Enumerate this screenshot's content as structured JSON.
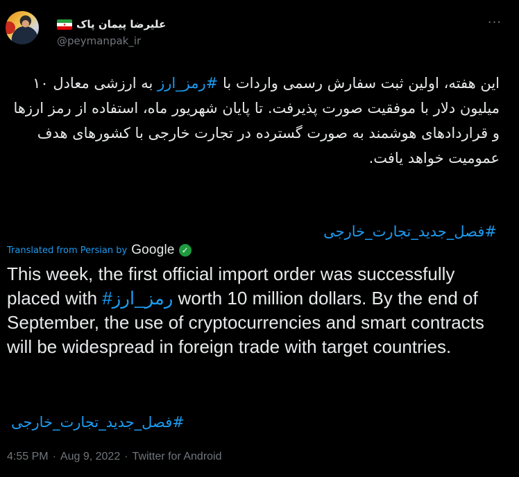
{
  "author": {
    "display_name": "علیرضا پیمان پاک",
    "handle": "@peymanpak_ir",
    "flag_icon": "iran-flag-icon"
  },
  "tweet": {
    "fa_before": "این هفته، اولین ثبت سفارش رسمی واردات با ",
    "fa_hashtag": "#رمز_ارز",
    "fa_after": " به ارزشی معادل ۱۰ میلیون دلار با موفقیت صورت پذیرفت. تا پایان شهریور ماه، استفاده از رمز ارزها و قراردادهای هوشمند به صورت گسترده در تجارت خارجی با کشورهای هدف عمومیت خواهد یافت.",
    "fa_hashtag2": "#فصل_جدید_تجارت_خارجی"
  },
  "translation": {
    "label": "Translated from Persian by",
    "provider": "Google",
    "en_before": "This week, the first official import order was successfully placed with ",
    "en_hashtag": "#رمز_ارز",
    "en_after": " worth 10 million dollars. By the end of September, the use of cryptocurrencies and smart contracts will be widespread in foreign trade with target countries.",
    "en_hashtag2": "#فصل_جدید_تجارت_خارجی"
  },
  "meta": {
    "time": "4:55 PM",
    "sep1": "·",
    "date": "Aug 9, 2022",
    "sep2": "·",
    "source": "Twitter for Android"
  },
  "colors": {
    "background": "#000000",
    "text": "#e7e9ea",
    "link": "#1d9bf0",
    "secondary": "#71767b"
  }
}
